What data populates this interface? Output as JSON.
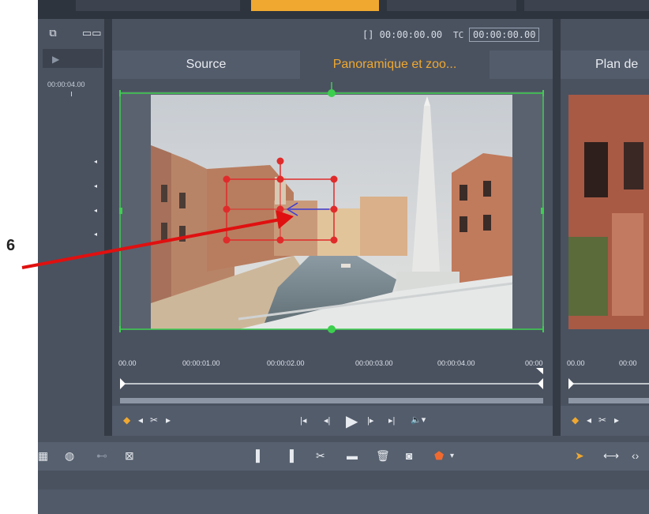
{
  "annotation": {
    "callout_number": "6",
    "arrow_color": "#e01010"
  },
  "left_panel": {
    "icons": [
      "multi-window-icon",
      "dual-view-icon"
    ],
    "timecode": "00:00:04.00",
    "arrows": [
      "◂",
      "◂",
      "◂",
      "◂"
    ]
  },
  "main_panel": {
    "tc_brackets": "[] 00:00:00.00",
    "tc_label": "TC",
    "tc_value": "00:00:00.00",
    "tabs": [
      {
        "label": "Source",
        "active": false
      },
      {
        "label": "Panoramique et zoo...",
        "active": true
      }
    ],
    "ruler": [
      "00.00",
      "00:00:01.00",
      "00:00:02.00",
      "00:00:03.00",
      "00:00:04.00",
      "00:00"
    ],
    "controls": {
      "left": [
        "◆",
        "◂",
        "✂",
        "▸"
      ],
      "transport": [
        "|◂",
        "◂|",
        "▶",
        "|▸",
        "▸|",
        "🔈▾"
      ]
    }
  },
  "right_panel": {
    "tab_label": "Plan de",
    "ruler": [
      "00.00",
      "00:00"
    ],
    "controls": [
      "◆",
      "◂",
      "✂",
      "▸"
    ]
  },
  "bottom_toolbar": {
    "left_icons": [
      "storyboard-icon",
      "color-wheel-icon",
      "link-icon",
      "image-edit-icon"
    ],
    "center_icons": [
      "mark-in-icon",
      "mark-out-icon",
      "split-icon",
      "insert-icon",
      "trash-icon",
      "snapshot-icon",
      "marker-icon",
      "dropdown-icon"
    ],
    "right_icons": [
      "pointer-icon",
      "trim-icon",
      "slip-icon"
    ]
  },
  "colors": {
    "accent": "#f0a830",
    "frame_green": "#3ccf4e",
    "keyframe_red": "#e02b2b",
    "panel_bg": "#4a5260"
  }
}
